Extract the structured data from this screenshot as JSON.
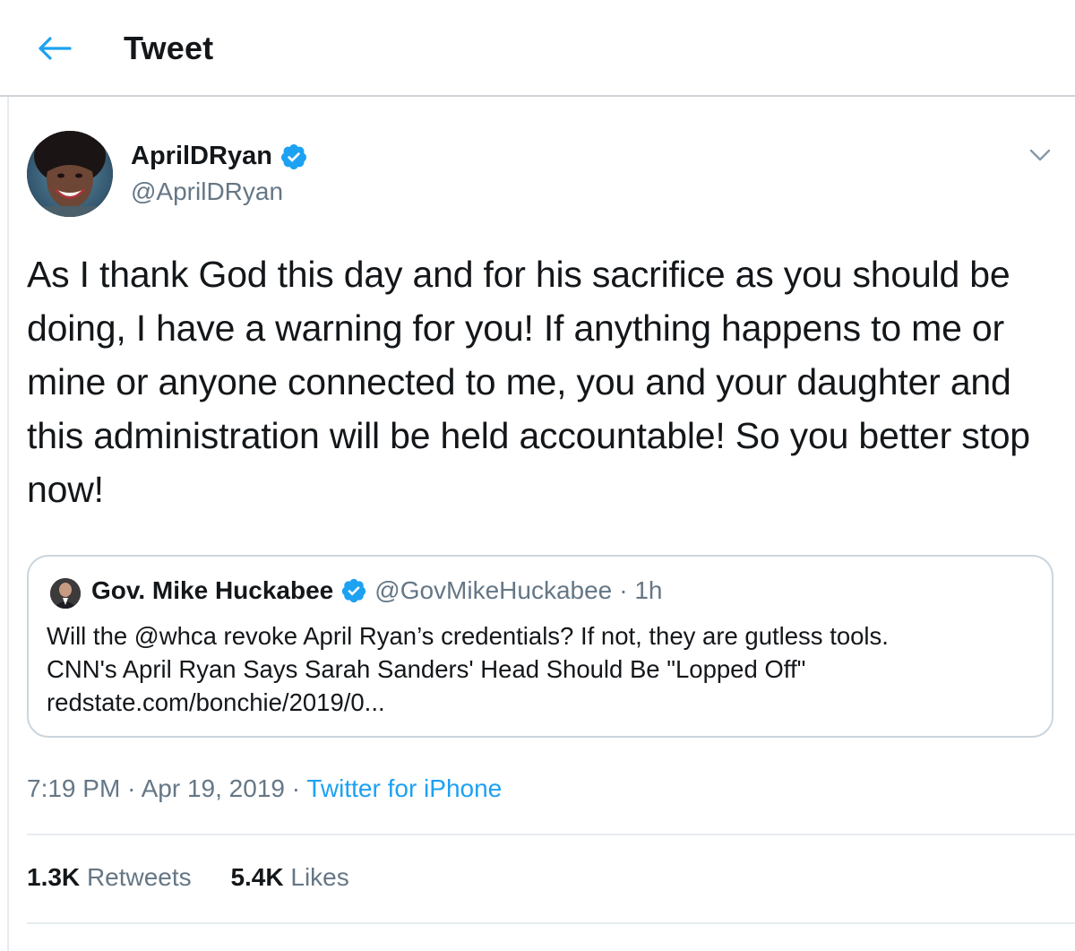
{
  "header": {
    "title": "Tweet",
    "back_icon": "arrow-left-icon",
    "accent": "#1da1f2"
  },
  "tweet": {
    "author_name": "AprilDRyan",
    "author_handle": "@AprilDRyan",
    "text": "As I thank God this day and for his sacrifice as you should be doing, I have a warning for you! If anything happens to me or mine or anyone connected to me, you and your daughter and this administration will be held accountable! So you better stop now!",
    "time": "7:19 PM",
    "date": "Apr 19, 2019",
    "source": "Twitter for iPhone",
    "separator": "·",
    "retweets_count": "1.3K",
    "retweets_label": "Retweets",
    "likes_count": "5.4K",
    "likes_label": "Likes"
  },
  "quoted": {
    "author_name": "Gov. Mike Huckabee",
    "author_handle": "@GovMikeHuckabee",
    "age": "· 1h",
    "line1": "Will the @whca revoke April Ryan’s credentials?  If not, they are gutless tools.",
    "line2": "CNN's April Ryan Says Sarah Sanders' Head Should Be \"Lopped Off\"",
    "line3": "redstate.com/bonchie/2019/0..."
  },
  "colors": {
    "text": "#14171a",
    "secondary": "#657786",
    "link": "#1da1f2",
    "border": "#ccd6dd"
  }
}
